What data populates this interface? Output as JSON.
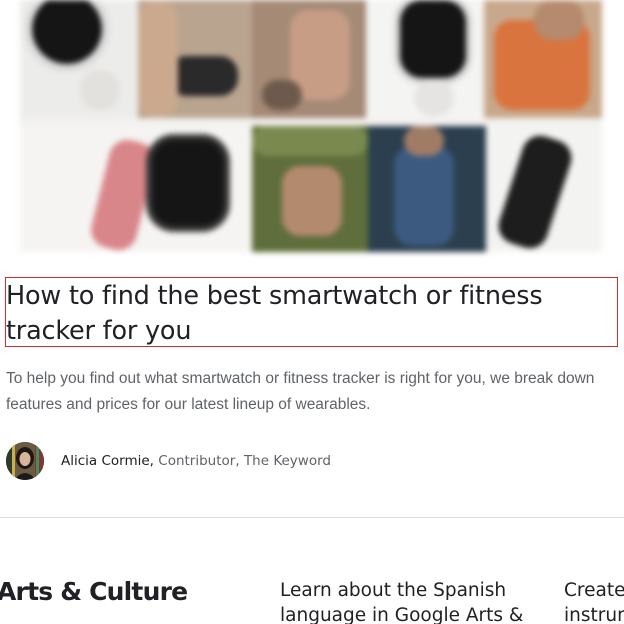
{
  "hero": {
    "image_label": "smartwatch-and-fitness-tracker-collage"
  },
  "article": {
    "title_line1": "How to find the best smartwatch or fitness",
    "title_line2": "tracker for you",
    "subtitle_line1": "To help you find out what smartwatch or fitness tracker is right for you, we break down",
    "subtitle_line2": "features and prices for our latest lineup of wearables."
  },
  "author": {
    "name": "Alicia Cormie,",
    "role": " Contributor, The Keyword"
  },
  "related": {
    "brand": "Arts & Culture",
    "card1_line1": "Learn about the Spanish",
    "card1_line2": "language in Google Arts &",
    "card2_line1": "Create",
    "card2_line2": "instrun"
  },
  "colors": {
    "title_border": "#d32f2f",
    "text_primary": "#202124",
    "text_secondary": "#5f6368",
    "divider": "#dadce0"
  }
}
